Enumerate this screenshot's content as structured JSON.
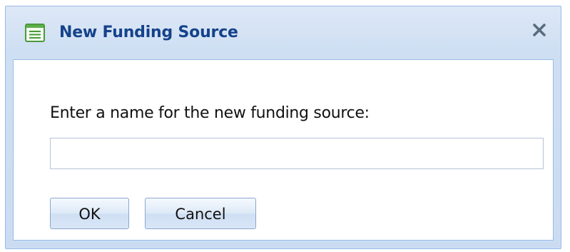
{
  "dialog": {
    "title": "New Funding Source",
    "title_icon": "form-window-icon",
    "close_icon": "close-icon",
    "close_label": "✕"
  },
  "form": {
    "prompt": "Enter a name for the new funding source:",
    "name_value": "",
    "name_placeholder": ""
  },
  "buttons": {
    "ok_label": "OK",
    "cancel_label": "Cancel"
  },
  "colors": {
    "title_text": "#15428b",
    "frame_border": "#99bbe8",
    "frame_background": "#cfdff3",
    "icon_green": "#4a9a3a"
  }
}
